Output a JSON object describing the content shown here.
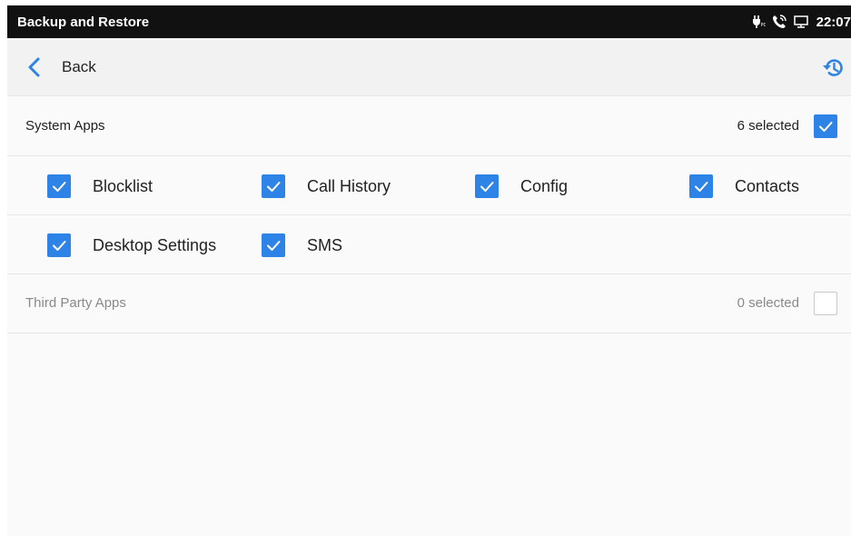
{
  "statusbar": {
    "title": "Backup and Restore",
    "icons": [
      "poe-power-icon",
      "phone-call-icon",
      "network-monitor-icon"
    ],
    "time": "22:07"
  },
  "navbar": {
    "back_label": "Back",
    "history_icon": "history-icon"
  },
  "system_apps": {
    "title": "System Apps",
    "count": "6 selected",
    "all_checked": true,
    "items": [
      {
        "label": "Blocklist",
        "checked": true
      },
      {
        "label": "Call History",
        "checked": true
      },
      {
        "label": "Config",
        "checked": true
      },
      {
        "label": "Contacts",
        "checked": true
      },
      {
        "label": "Desktop Settings",
        "checked": true
      },
      {
        "label": "SMS",
        "checked": true
      }
    ]
  },
  "third_party_apps": {
    "title": "Third Party Apps",
    "count": "0 selected",
    "all_checked": false
  },
  "colors": {
    "accent": "#2e84e6",
    "statusbar": "#111111",
    "navbar": "#f2f2f2",
    "muted_text": "#8a8a8a"
  }
}
